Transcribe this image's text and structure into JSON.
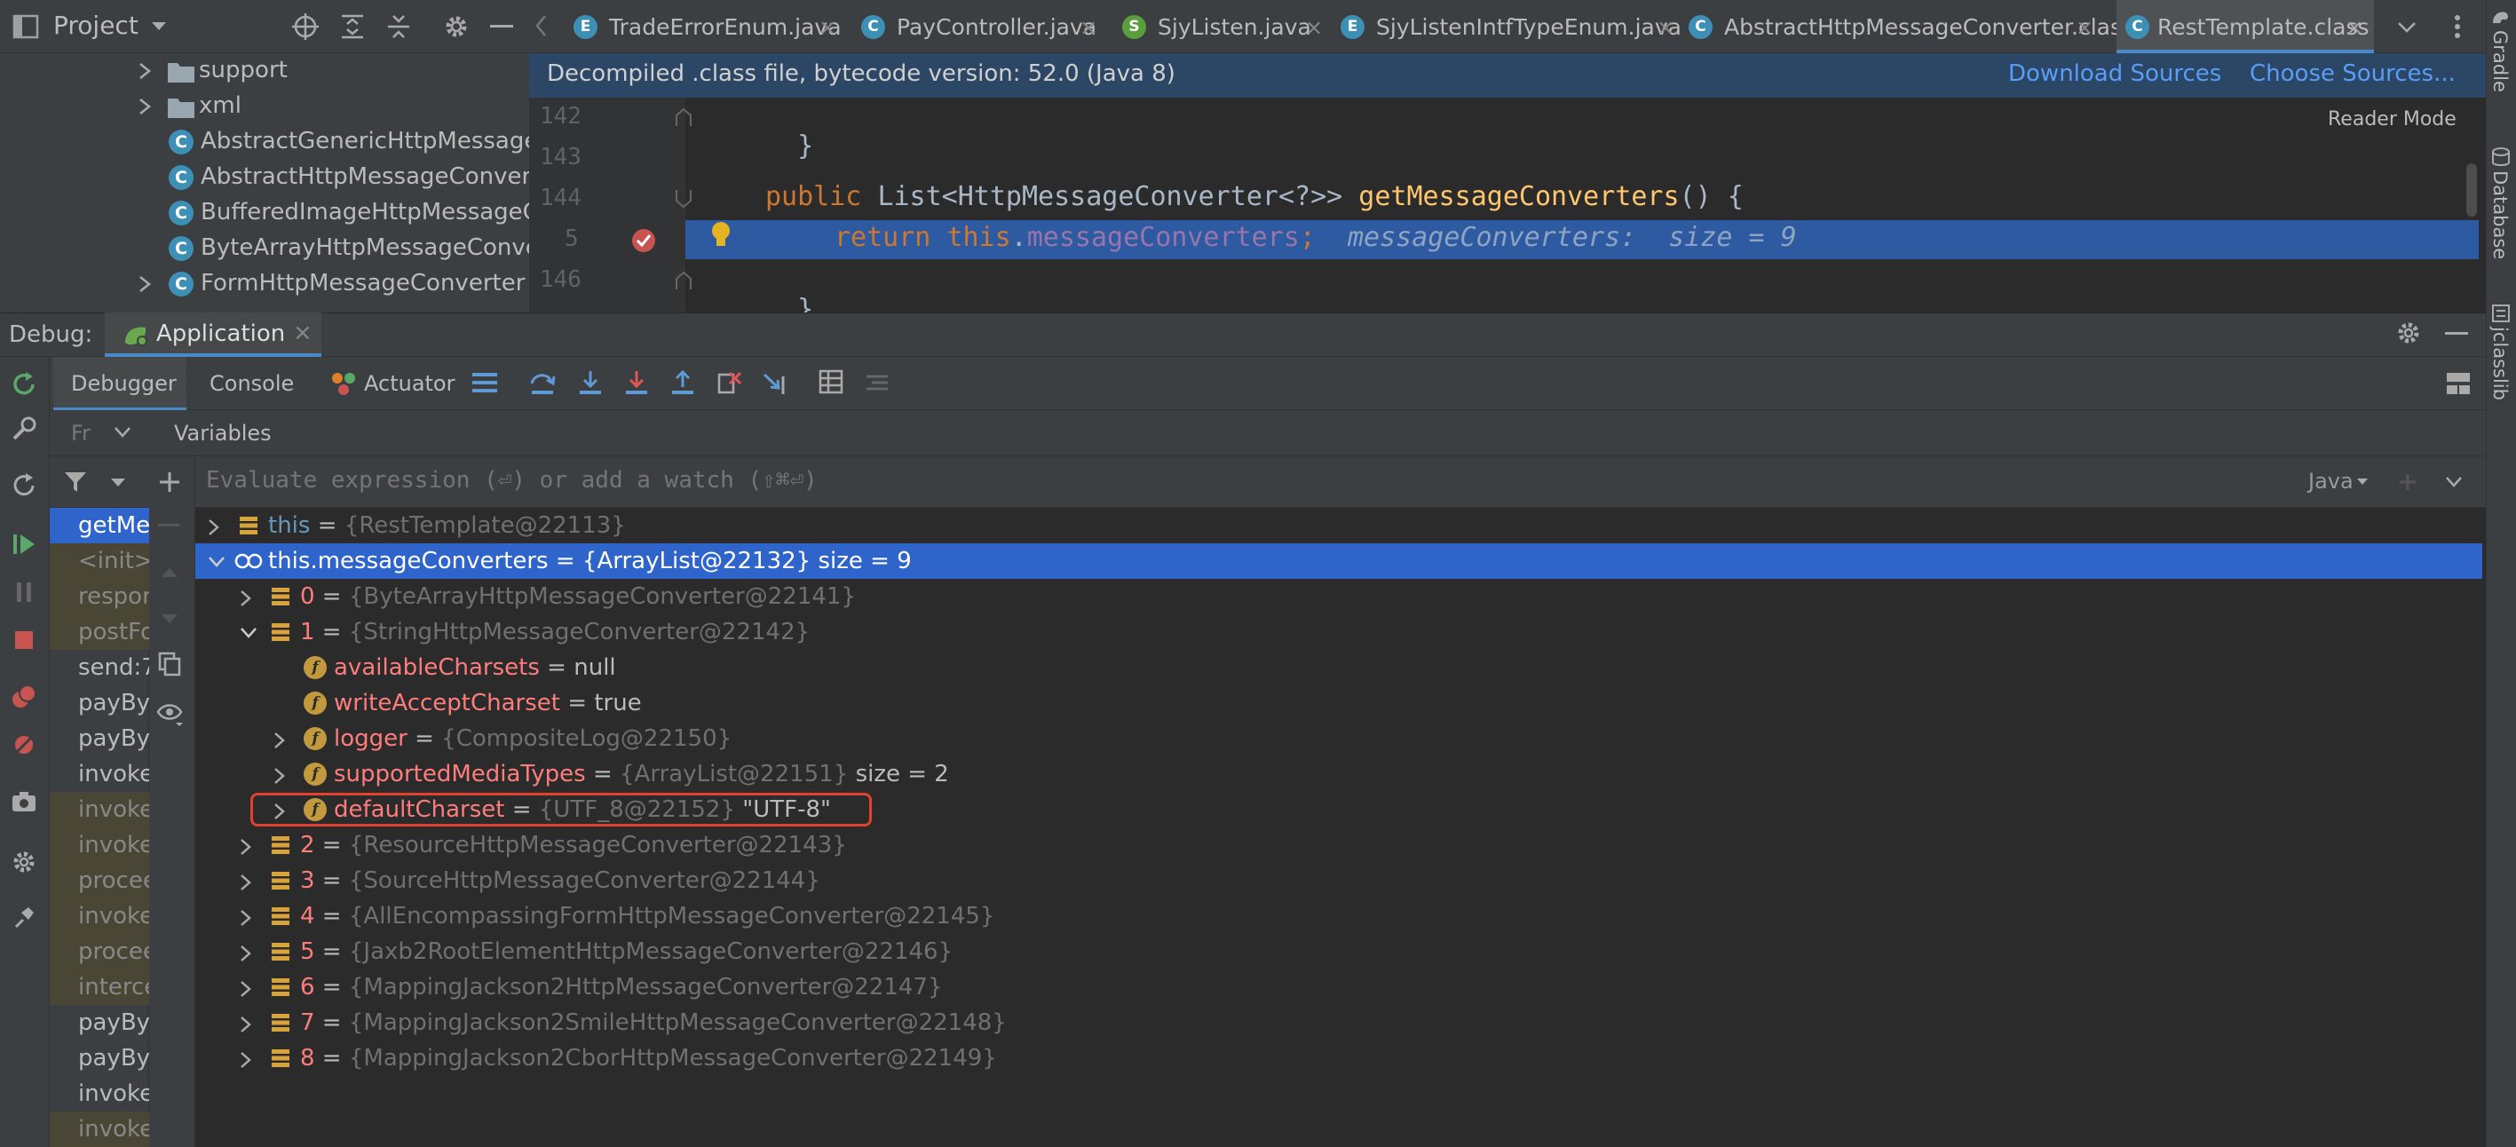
{
  "project": {
    "title": "Project",
    "tree": [
      {
        "label": "support",
        "kind": "folder"
      },
      {
        "label": "xml",
        "kind": "folder"
      },
      {
        "label": "AbstractGenericHttpMessageConverter",
        "kind": "class"
      },
      {
        "label": "AbstractHttpMessageConverter",
        "kind": "class"
      },
      {
        "label": "BufferedImageHttpMessageConverter",
        "kind": "class"
      },
      {
        "label": "ByteArrayHttpMessageConverter",
        "kind": "class"
      },
      {
        "label": "FormHttpMessageConverter",
        "kind": "class"
      }
    ]
  },
  "tabs": [
    {
      "label": "TradeErrorEnum.java",
      "icon": "enum-icon"
    },
    {
      "label": "PayController.java",
      "icon": "class-icon"
    },
    {
      "label": "SjyListen.java",
      "icon": "spring-icon"
    },
    {
      "label": "SjyListenIntfTypeEnum.java",
      "icon": "enum-icon"
    },
    {
      "label": "AbstractHttpMessageConverter.class",
      "icon": "class-icon"
    },
    {
      "label": "RestTemplate.class",
      "icon": "class-icon"
    }
  ],
  "editor": {
    "banner": "Decompiled .class file, bytecode version: 52.0 (Java 8)",
    "download_sources": "Download Sources",
    "choose_sources": "Choose Sources...",
    "reader_mode": "Reader Mode",
    "line_numbers": [
      "142",
      "143",
      "144",
      "5",
      "146"
    ],
    "lines": {
      "l142": "}",
      "l144_kw": "public",
      "l144_type": "List<HttpMessageConverter<?>>",
      "l144_fn": "getMessageConverters",
      "l144_tail": "() {",
      "l145_kw": "return",
      "l145_this": "this",
      "l145_dot": ".",
      "l145_fld": "messageConverters",
      "l145_semi": ";",
      "l145_hint": "messageConverters:  size = 9",
      "l146": "}"
    }
  },
  "side_tools": [
    "Gradle",
    "Database",
    "jclasslib"
  ],
  "debug": {
    "label": "Debug:",
    "app_tab": "Application",
    "tabs": {
      "debugger": "Debugger",
      "console": "Console",
      "actuator": "Actuator"
    },
    "frames_label": "Fr",
    "variables_label": "Variables",
    "eval_placeholder": "Evaluate expression (⏎) or add a watch (⇧⌘⏎)",
    "eval_lang": "Java",
    "frames": [
      {
        "label": "getMe",
        "kind": "sel"
      },
      {
        "label": "<init>",
        "kind": "lib"
      },
      {
        "label": "respor",
        "kind": "lib"
      },
      {
        "label": "postFo",
        "kind": "lib"
      },
      {
        "label": "send:7",
        "kind": "app"
      },
      {
        "label": "payBy(",
        "kind": "app"
      },
      {
        "label": "payBy(",
        "kind": "app"
      },
      {
        "label": "invoke",
        "kind": "app"
      },
      {
        "label": "invoke",
        "kind": "lib"
      },
      {
        "label": "invoke",
        "kind": "lib"
      },
      {
        "label": "procee",
        "kind": "lib"
      },
      {
        "label": "invoke",
        "kind": "lib"
      },
      {
        "label": "procee",
        "kind": "lib"
      },
      {
        "label": "interce",
        "kind": "lib"
      },
      {
        "label": "payBy(",
        "kind": "app"
      },
      {
        "label": "payBy(",
        "kind": "app"
      },
      {
        "label": "invoke",
        "kind": "app"
      },
      {
        "label": "invoke",
        "kind": "lib"
      }
    ],
    "variables": [
      {
        "name": "this",
        "value": "{RestTemplate@22113}",
        "extra": "",
        "level": 0,
        "expand": "collapsed",
        "icon": "object-icon",
        "nclass": "kw"
      },
      {
        "name": "this.messageConverters",
        "value": "{ArrayList@22132}",
        "extra": "size = 9",
        "level": 0,
        "expand": "expanded",
        "icon": "watch-icon",
        "nclass": "plain"
      },
      {
        "name": "0",
        "value": "{ByteArrayHttpMessageConverter@22141}",
        "extra": "",
        "level": 1,
        "expand": "collapsed",
        "icon": "object-icon",
        "nclass": "idx"
      },
      {
        "name": "1",
        "value": "{StringHttpMessageConverter@22142}",
        "extra": "",
        "level": 1,
        "expand": "expanded",
        "icon": "object-icon",
        "nclass": "idx"
      },
      {
        "name": "availableCharsets",
        "value": "null",
        "extra": "",
        "level": 2,
        "expand": "none",
        "icon": "field-icon",
        "nclass": "field",
        "plainval": true
      },
      {
        "name": "writeAcceptCharset",
        "value": "true",
        "extra": "",
        "level": 2,
        "expand": "none",
        "icon": "field-icon",
        "nclass": "field",
        "plainval": true
      },
      {
        "name": "logger",
        "value": "{CompositeLog@22150}",
        "extra": "",
        "level": 2,
        "expand": "collapsed",
        "icon": "field-icon",
        "nclass": "field"
      },
      {
        "name": "supportedMediaTypes",
        "value": "{ArrayList@22151}",
        "extra": "size = 2",
        "level": 2,
        "expand": "collapsed",
        "icon": "field-icon",
        "nclass": "field"
      },
      {
        "name": "defaultCharset",
        "value": "{UTF_8@22152}",
        "extra": "\"UTF-8\"",
        "level": 2,
        "expand": "collapsed",
        "icon": "field-icon",
        "nclass": "field"
      },
      {
        "name": "2",
        "value": "{ResourceHttpMessageConverter@22143}",
        "extra": "",
        "level": 1,
        "expand": "collapsed",
        "icon": "object-icon",
        "nclass": "idx"
      },
      {
        "name": "3",
        "value": "{SourceHttpMessageConverter@22144}",
        "extra": "",
        "level": 1,
        "expand": "collapsed",
        "icon": "object-icon",
        "nclass": "idx"
      },
      {
        "name": "4",
        "value": "{AllEncompassingFormHttpMessageConverter@22145}",
        "extra": "",
        "level": 1,
        "expand": "collapsed",
        "icon": "object-icon",
        "nclass": "idx"
      },
      {
        "name": "5",
        "value": "{Jaxb2RootElementHttpMessageConverter@22146}",
        "extra": "",
        "level": 1,
        "expand": "collapsed",
        "icon": "object-icon",
        "nclass": "idx"
      },
      {
        "name": "6",
        "value": "{MappingJackson2HttpMessageConverter@22147}",
        "extra": "",
        "level": 1,
        "expand": "collapsed",
        "icon": "object-icon",
        "nclass": "idx"
      },
      {
        "name": "7",
        "value": "{MappingJackson2SmileHttpMessageConverter@22148}",
        "extra": "",
        "level": 1,
        "expand": "collapsed",
        "icon": "object-icon",
        "nclass": "idx"
      },
      {
        "name": "8",
        "value": "{MappingJackson2CborHttpMessageConverter@22149}",
        "extra": "",
        "level": 1,
        "expand": "collapsed",
        "icon": "object-icon",
        "nclass": "idx"
      }
    ]
  },
  "colors": {
    "accent": "#4a88c7",
    "selection": "#2f65ca",
    "highlight_box": "#e2412d"
  }
}
